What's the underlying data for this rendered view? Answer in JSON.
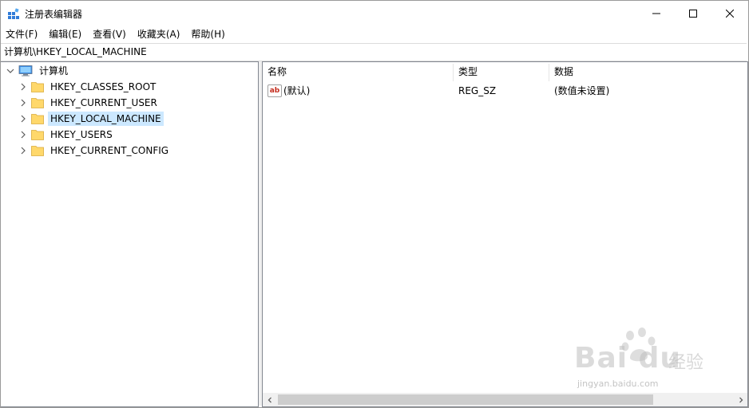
{
  "window": {
    "title": "注册表编辑器"
  },
  "menu": [
    "文件(F)",
    "编辑(E)",
    "查看(V)",
    "收藏夹(A)",
    "帮助(H)"
  ],
  "address": {
    "path": "计算机\\HKEY_LOCAL_MACHINE"
  },
  "tree": {
    "root": {
      "label": "计算机",
      "icon": "computer-icon",
      "expanded": true
    },
    "children": [
      {
        "label": "HKEY_CLASSES_ROOT",
        "selected": false
      },
      {
        "label": "HKEY_CURRENT_USER",
        "selected": false
      },
      {
        "label": "HKEY_LOCAL_MACHINE",
        "selected": true
      },
      {
        "label": "HKEY_USERS",
        "selected": false
      },
      {
        "label": "HKEY_CURRENT_CONFIG",
        "selected": false
      }
    ]
  },
  "list": {
    "columns": [
      "名称",
      "类型",
      "数据"
    ],
    "rows": [
      {
        "icon": "string-value-icon",
        "icon_text": "ab",
        "name": "(默认)",
        "type": "REG_SZ",
        "data": "(数值未设置)"
      }
    ]
  },
  "watermark": {
    "logo": "Bai du",
    "brand": "经验",
    "url": "jingyan.baidu.com"
  },
  "colors": {
    "selection": "#cce8ff",
    "folder": "#ffd86b",
    "computer": "#3c8ee6",
    "value_icon_text": "#c42b1c"
  }
}
